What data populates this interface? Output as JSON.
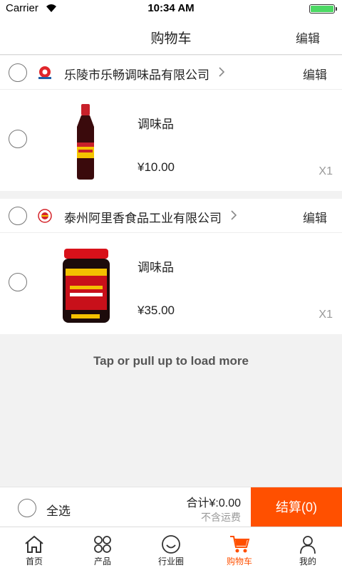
{
  "status_bar": {
    "carrier": "Carrier",
    "time": "10:34 AM"
  },
  "nav": {
    "title": "购物车",
    "edit_label": "编辑"
  },
  "shops": [
    {
      "name": "乐陵市乐畅调味品有限公司",
      "edit_label": "编辑",
      "items": [
        {
          "name": "调味品",
          "price": "¥10.00",
          "quantity": "X1"
        }
      ]
    },
    {
      "name": "泰州阿里香食品工业有限公司",
      "edit_label": "编辑",
      "items": [
        {
          "name": "调味品",
          "price": "¥35.00",
          "quantity": "X1"
        }
      ]
    }
  ],
  "load_more": "Tap or pull up to load more",
  "checkout": {
    "select_all_label": "全选",
    "total": "合计¥:0.00",
    "shipping_note": "不含运费",
    "checkout_button": "结算(0)"
  },
  "tabs": [
    {
      "label": "首页",
      "icon": "home-icon",
      "active": false
    },
    {
      "label": "产品",
      "icon": "grid-icon",
      "active": false
    },
    {
      "label": "行业圈",
      "icon": "smile-icon",
      "active": false
    },
    {
      "label": "购物车",
      "icon": "cart-icon",
      "active": true
    },
    {
      "label": "我的",
      "icon": "person-icon",
      "active": false
    }
  ],
  "colors": {
    "accent": "#ff5000",
    "background": "#f2f2f2",
    "battery": "#4cd964"
  }
}
